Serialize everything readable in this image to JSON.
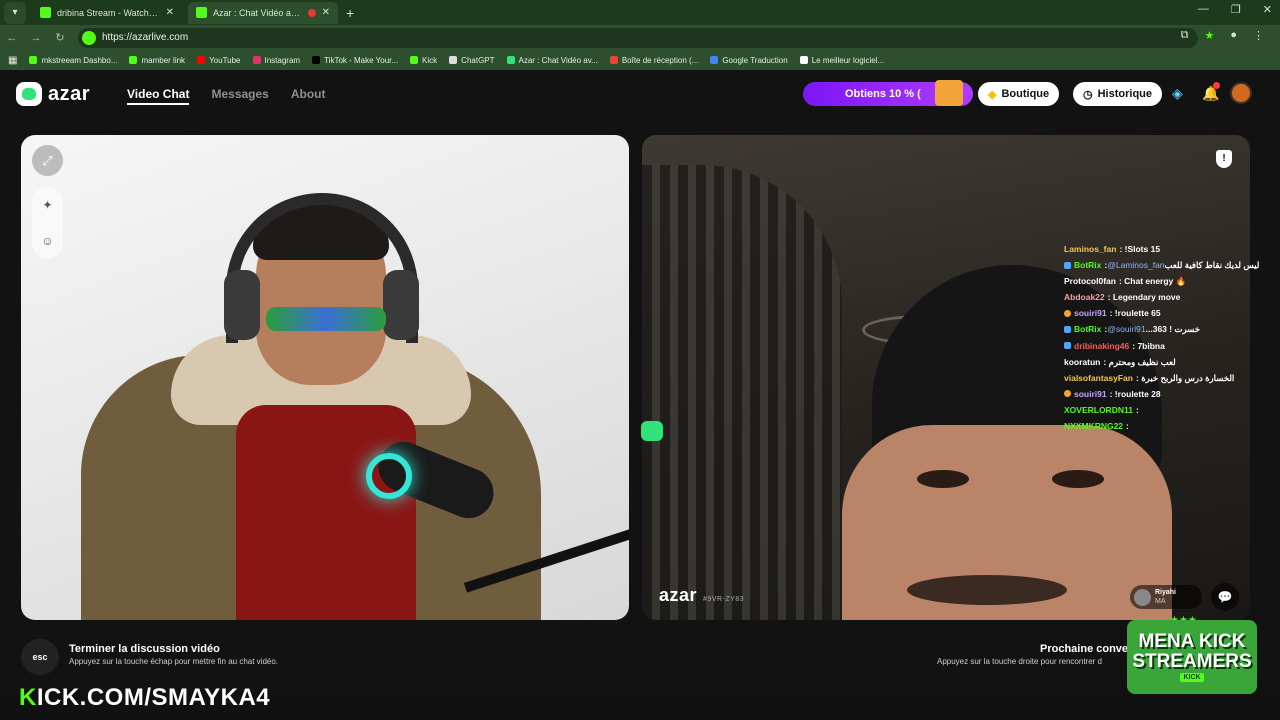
{
  "browser": {
    "tabs": [
      {
        "label": "dribina Stream - Watch Live on",
        "active": false
      },
      {
        "label": "Azar : Chat Vidéo avec de",
        "active": true
      }
    ],
    "url": "https://azarlive.com",
    "bookmarks": [
      "mkstreeam Dashbo...",
      "mamber link",
      "YouTube",
      "Instagram",
      "TikTok - Make Your...",
      "Kick",
      "ChatGPT",
      "Azar : Chat Vidéo av...",
      "Boîte de réception (...",
      "Google Traduction",
      "Le meilleur logiciel..."
    ]
  },
  "app": {
    "logo": "azar",
    "menu": [
      "Video Chat",
      "Messages",
      "About"
    ],
    "promo": "Obtiens 10 % (",
    "boutique": "Boutique",
    "historique": "Historique"
  },
  "chat": [
    {
      "user": "Laminos_fan",
      "color": "#f5c84c",
      "badge": "",
      "msg": ": !Slots 15"
    },
    {
      "user": "BotRix",
      "color": "#53fc18",
      "badge": "b",
      "mention": "@Laminos_fan",
      "msg": " ليس لديك نقاط كافية للعب"
    },
    {
      "user": "Protocol0fan",
      "color": "#ffffff",
      "badge": "",
      "msg": ": Chat energy 🔥"
    },
    {
      "user": "Abdoak22",
      "color": "#f5a3a3",
      "badge": "",
      "msg": ": Legendary move"
    },
    {
      "user": "souiri91",
      "color": "#c9a3ff",
      "badge": "o",
      "msg": ": !roulette 65"
    },
    {
      "user": "BotRix",
      "color": "#53fc18",
      "badge": "b",
      "mention": "@souiri91",
      "msg": " ...363 ! خسرت"
    },
    {
      "user": "dribinaking46",
      "color": "#ff5a5a",
      "badge": "b",
      "msg": ": 7bibna"
    },
    {
      "user": "kooratun",
      "color": "#ffffff",
      "badge": "",
      "msg": ": لعب نظيف ومحترم"
    },
    {
      "user": "vialsofantasyFan",
      "color": "#f5c84c",
      "badge": "",
      "msg": ": الخسارة درس والربح خبرة"
    },
    {
      "user": "souiri91",
      "color": "#c9a3ff",
      "badge": "o",
      "msg": ": !roulette 28"
    },
    {
      "user": "XOVERLORDN11",
      "color": "#53fc18",
      "badge": "",
      "msg": ":"
    },
    {
      "user": "NXXMKRNG22",
      "color": "#53fc18",
      "badge": "",
      "msg": ":"
    }
  ],
  "video": {
    "watermark": "azar",
    "watermark_id": "#9VR-ZY83",
    "peer_name": "Riyahi",
    "peer_country": "MA"
  },
  "footer": {
    "esc": "esc",
    "end_title": "Terminer la discussion vidéo",
    "end_sub": "Appuyez sur la touche échap pour mettre fin au chat vidéo.",
    "next_title": "Prochaine conve",
    "next_sub": "Appuyez sur la touche droite pour rencontrer d"
  },
  "overlay": {
    "kick_url_prefix": "K",
    "kick_url_rest": "ICK.COM/SMAYKA4",
    "mena_line1": "MENA KICK",
    "mena_line2": "STREAMERS",
    "mena_small": "KICK"
  }
}
